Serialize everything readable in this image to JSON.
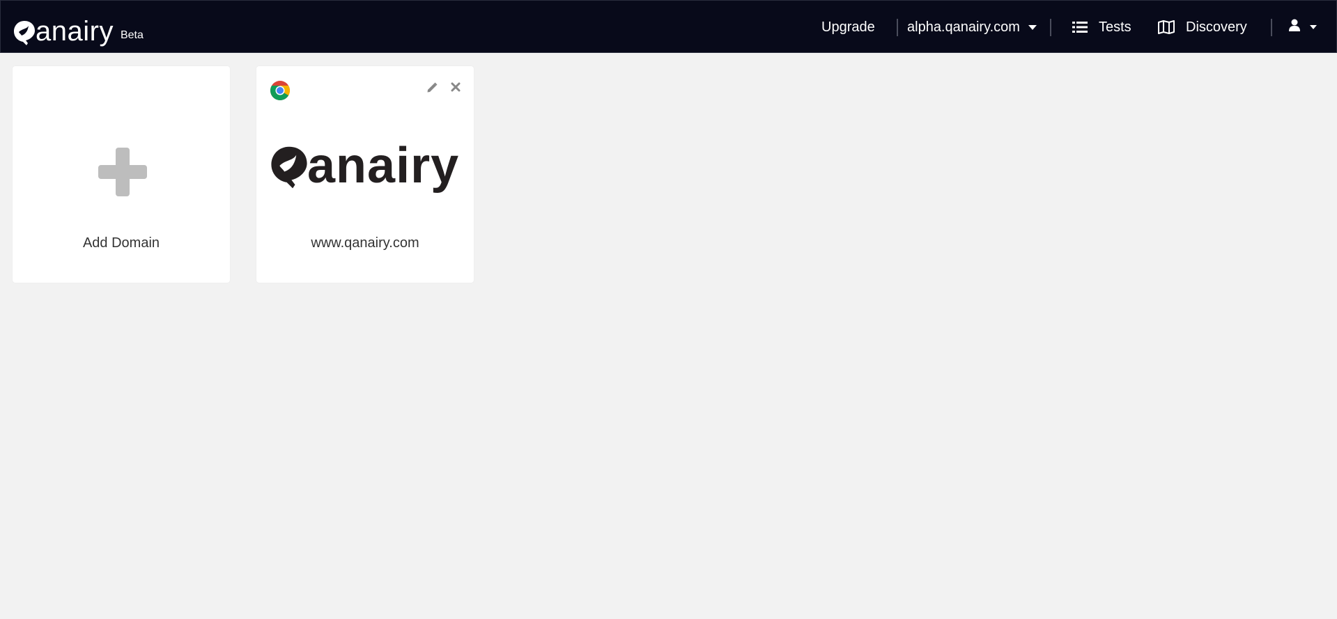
{
  "navbar": {
    "brand_name": "anairy",
    "beta_label": "Beta",
    "upgrade_label": "Upgrade",
    "domain_selector": "alpha.qanairy.com",
    "tests_label": "Tests",
    "discovery_label": "Discovery",
    "icons": [
      "bird-q-logo",
      "caret-down-icon",
      "list-icon",
      "map-icon",
      "user-icon"
    ],
    "background_color": "#080a1a"
  },
  "cards": {
    "add_domain": {
      "label": "Add Domain",
      "icon": "plus-icon",
      "icon_color": "#bdbdbd"
    },
    "domain": {
      "url": "www.qanairy.com",
      "browser_icon": "chrome-icon",
      "logo_word": "anairy",
      "actions": [
        "pencil-icon",
        "close-icon"
      ]
    }
  },
  "page_background": "#f2f2f2"
}
